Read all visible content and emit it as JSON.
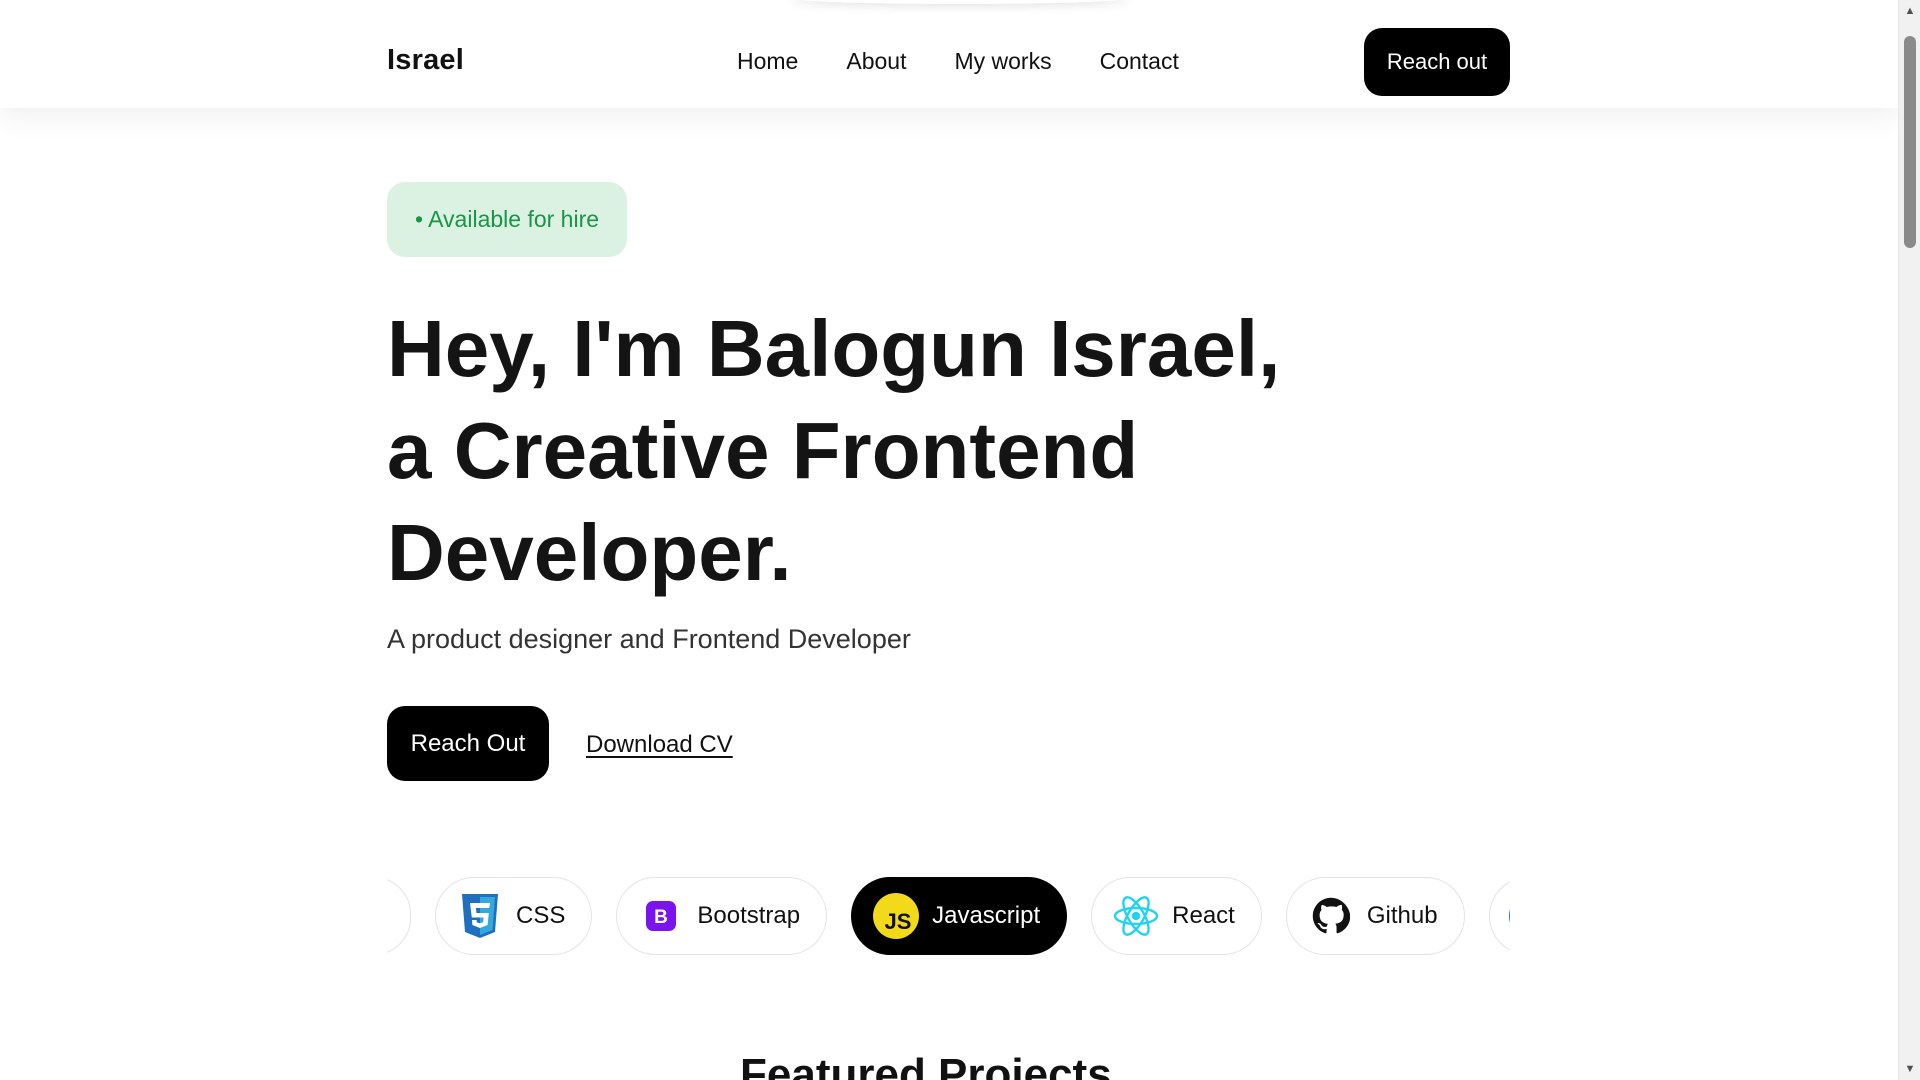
{
  "header": {
    "brand": "Israel",
    "nav": [
      "Home",
      "About",
      "My works",
      "Contact"
    ],
    "cta": "Reach out"
  },
  "hero": {
    "badge": "• Available for hire",
    "headline_lines": [
      "Hey, I'm Balogun Israel,",
      "a Creative Frontend",
      "Developer."
    ],
    "subtitle": "A product designer and Frontend Developer",
    "primary_button": "Reach Out",
    "secondary_link": "Download CV"
  },
  "skills": [
    {
      "label": "-",
      "icon": "html-icon",
      "active": false
    },
    {
      "label": "CSS",
      "icon": "css-icon",
      "active": false
    },
    {
      "label": "Bootstrap",
      "icon": "bootstrap-icon",
      "active": false
    },
    {
      "label": "Javascript",
      "icon": "javascript-icon",
      "active": true
    },
    {
      "label": "React",
      "icon": "react-icon",
      "active": false
    },
    {
      "label": "Github",
      "icon": "github-icon",
      "active": false
    },
    {
      "label": "",
      "icon": "typescript-icon",
      "active": false
    }
  ],
  "section": {
    "featured_title": "Featured Projects"
  },
  "colors": {
    "accent_black": "#000000",
    "badge_bg": "#dbf2e2",
    "badge_text": "#1b9449",
    "css_blue": "#1f6fc0",
    "bootstrap_purple": "#7b13ee",
    "js_yellow": "#f2d91a",
    "react_cyan": "#22d3ee",
    "ts_blue": "#1e78c8"
  }
}
